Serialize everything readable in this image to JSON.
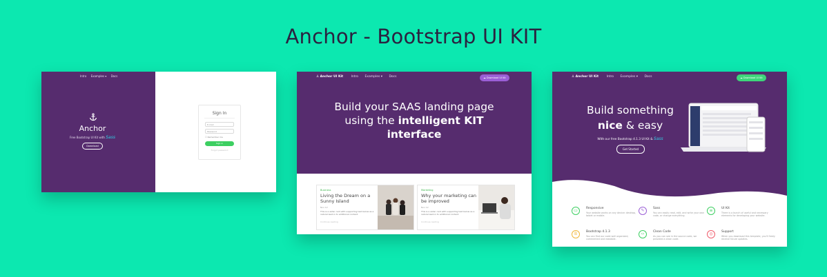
{
  "title": "Anchor - Bootstrap UI KIT",
  "colors": {
    "background": "#0ce8b0",
    "brand_purple": "#562c6e",
    "accent_green": "#3dcf61",
    "accent_violet": "#9b5fd6"
  },
  "signin_preview": {
    "nav": [
      "Intro",
      "Examples ▾",
      "Docs"
    ],
    "anchor_icon": "anchor-icon",
    "brand": "Anchor",
    "tagline": "Free Bootstrap UI Kit with",
    "tagline_signature": "Sass",
    "download": "Download",
    "card_title": "Sign In",
    "email_placeholder": "E-mail",
    "password_placeholder": "Password",
    "remember": "Remember me",
    "signin_button": "Sign in",
    "forgot": "Forgot password"
  },
  "landing_preview": {
    "logo": "Anchor UI Kit",
    "nav": [
      "Intro",
      "Examples ▾",
      "Docs"
    ],
    "download_button": "Download UI Kit",
    "headline_line1": "Build your SAAS landing page",
    "headline_pre": "using the ",
    "headline_bold": "intelligent KIT",
    "headline_line3": "interface",
    "posts": [
      {
        "category": "Business",
        "title": "Living the Dream on a Sunny Island",
        "date": "Nov 12",
        "text": "This is a wider card with supporting text below as a natural lead-in to additional content.",
        "more": "Continue reading"
      },
      {
        "category": "Marketing",
        "title": "Why your marketing can be improved",
        "date": "Nov 12",
        "text": "This is a wider card with supporting text below as a natural lead-in to additional content.",
        "more": "Continue reading"
      }
    ]
  },
  "features_preview": {
    "logo": "Anchor UI Kit",
    "nav": [
      "Intro",
      "Examples ▾",
      "Docs"
    ],
    "download_button": "Download UI Kit",
    "headline_line1": "Build something",
    "headline_bold": "nice",
    "headline_rest": " & easy",
    "sub": "With our free Bootstrap 4.1.3 UI Kit &",
    "sub_signature": "Sass",
    "cta": "Get Started",
    "features": [
      {
        "name": "Responsive",
        "desc": "Your website works on any device: desktop, tablet or mobile.",
        "color": "#3dcf61",
        "icon": "monitor-icon"
      },
      {
        "name": "Sass",
        "desc": "You can easily read, edit, and write your own code, or change everything.",
        "color": "#9b5fd6",
        "icon": "pencil-icon"
      },
      {
        "name": "UI Kit",
        "desc": "There is a bunch of useful and necessary elements for developing your website.",
        "color": "#3dcf61",
        "icon": "layers-icon"
      },
      {
        "name": "Bootstrap 4.1.3",
        "desc": "You can find our code well organized, commented and readable.",
        "color": "#f0b73a",
        "icon": "bootstrap-icon"
      },
      {
        "name": "Clean Code",
        "desc": "As you can see in the source code, we provided a clean code.",
        "color": "#3dcf61",
        "icon": "code-icon"
      },
      {
        "name": "Support",
        "desc": "When you download this template, you'll freely receive future updates.",
        "color": "#ef5b6b",
        "icon": "lifebuoy-icon"
      }
    ]
  }
}
